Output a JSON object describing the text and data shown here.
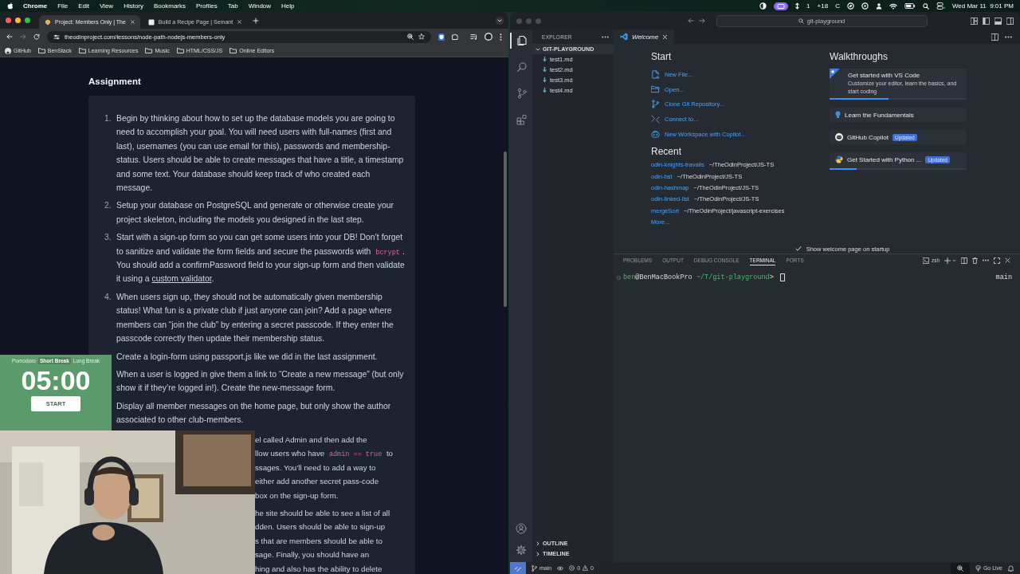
{
  "menu_bar": {
    "app": "Chrome",
    "menus": [
      "File",
      "Edit",
      "View",
      "History",
      "Bookmarks",
      "Profiles",
      "Tab",
      "Window",
      "Help"
    ],
    "status": [
      "1",
      "+18",
      "C"
    ],
    "clock": "Wed Mar 11  9:01 PM"
  },
  "browser": {
    "tabs": [
      {
        "title": "Project: Members Only | The",
        "selected": true
      },
      {
        "title": "Build a Recipe Page | Semant",
        "selected": false
      }
    ],
    "url": "theodinproject.com/lessons/node-path-nodejs-members-only",
    "bookmarks": [
      {
        "kind": "github",
        "label": "GitHub"
      },
      {
        "kind": "folder",
        "label": "BenStack"
      },
      {
        "kind": "folder",
        "label": "Learning Resources"
      },
      {
        "kind": "folder",
        "label": "Music"
      },
      {
        "kind": "folder",
        "label": "HTML/CSS/JS"
      },
      {
        "kind": "folder",
        "label": "Online Editors"
      }
    ],
    "page": {
      "heading": "Assignment",
      "items": [
        {
          "number": "1.",
          "parts": [
            {
              "text": "Begin by thinking about how to set up the database models you are going to need to accomplish your goal. You will need users with full-names (first and last), usernames (you can use email for this), passwords and membership-status. Users should be able to create messages that have a title, a timestamp and some text. Your database should keep track of who created each message."
            }
          ]
        },
        {
          "number": "2.",
          "parts": [
            {
              "text": "Setup your database on PostgreSQL and generate or otherwise create your project skeleton, including the models you designed in the last step."
            }
          ]
        },
        {
          "number": "3.",
          "parts": [
            {
              "text": "Start with a sign-up form so you can get some users into your DB! Don’t forget to sanitize and validate the form fields and secure the passwords with "
            },
            {
              "kind": "code",
              "text": "bcrypt"
            },
            {
              "text": ". You should add a confirmPassword field to your sign-up form and then validate it using a "
            },
            {
              "kind": "link",
              "text": "custom validator"
            },
            {
              "text": "."
            }
          ]
        },
        {
          "number": "4.",
          "parts": [
            {
              "text": "When users sign up, they should not be automatically given membership status! What fun is a private club if just anyone can join? Add a page where members can “join the club” by entering a secret passcode. If they enter the passcode correctly then update their membership status."
            }
          ]
        },
        {
          "parts": [
            {
              "text": "Create a login-form using passport.js like we did in the last assignment."
            }
          ]
        },
        {
          "parts": [
            {
              "text": "When a user is logged in give them a link to “Create a new message” (but only show it if they’re logged in!). Create the new-message form."
            }
          ]
        },
        {
          "parts": [
            {
              "text": "Display all member messages on the home page, but only show the author associated to other club-members."
            }
          ]
        }
      ],
      "fragments": [
        {
          "lines": [
            [
              {
                "text": "el called Admin and then add the"
              }
            ],
            [
              {
                "text": "llow users who have "
              },
              {
                "kind": "code",
                "text": "admin == true"
              },
              {
                "text": " to"
              }
            ],
            [
              {
                "text": "ssages. You’ll need to add a way to"
              }
            ],
            [
              {
                "text": "either add another secret pass-code"
              }
            ],
            [
              {
                "text": "box on the sign-up form."
              }
            ]
          ]
        },
        {
          "lines": [
            [
              {
                "text": "he site should be able to see a list of all"
              }
            ],
            [
              {
                "text": "dden. Users should be able to sign-up"
              }
            ],
            [
              {
                "text": "s that are members should be able to"
              }
            ],
            [
              {
                "text": "sage. Finally, you should have an"
              }
            ],
            [
              {
                "text": "hing and also has the ability to delete"
              }
            ]
          ]
        }
      ]
    }
  },
  "timer": {
    "modes": [
      {
        "label": "Pomodoro",
        "selected": false
      },
      {
        "label": "Short Break",
        "selected": true
      },
      {
        "label": "Long Break",
        "selected": false
      }
    ],
    "time": "05:00",
    "button": "START"
  },
  "editor": {
    "search": "git-playground",
    "activity": [
      {
        "kind": "files",
        "selected": true
      },
      {
        "kind": "search",
        "selected": false
      },
      {
        "kind": "source-control",
        "selected": false
      },
      {
        "kind": "extensions",
        "selected": false
      }
    ],
    "explorer": {
      "title": "EXPLORER",
      "folder": {
        "name": "GIT-PLAYGROUND",
        "expanded": true,
        "files": [
          "test1.md",
          "test2.md",
          "test3.md",
          "test4.md"
        ]
      },
      "sections": [
        {
          "name": "OUTLINE",
          "expanded": false
        },
        {
          "name": "TIMELINE",
          "expanded": false
        }
      ]
    },
    "tabs": [
      {
        "title": "Welcome",
        "selected": true
      }
    ],
    "welcome": {
      "start_title": "Start",
      "start": [
        {
          "kind": "new-file",
          "label": "New File..."
        },
        {
          "kind": "open",
          "label": "Open..."
        },
        {
          "kind": "clone",
          "label": "Clone Git Repository..."
        },
        {
          "kind": "connect",
          "label": "Connect to..."
        },
        {
          "kind": "copilot",
          "label": "New Workspace with Copilot..."
        }
      ],
      "recent_title": "Recent",
      "recent": [
        {
          "name": "odin-knights-travails",
          "path": "~/TheOdinProject/JS-TS"
        },
        {
          "name": "odin-bst",
          "path": "~/TheOdinProject/JS-TS"
        },
        {
          "name": "odin-hashmap",
          "path": "~/TheOdinProject/JS-TS"
        },
        {
          "name": "odin-linked-list",
          "path": "~/TheOdinProject/JS-TS"
        },
        {
          "name": "mergeSort",
          "path": "~/TheOdinProject/javascript-exercises"
        }
      ],
      "more": "More...",
      "walkthroughs_title": "Walkthroughs",
      "walkthroughs": [
        {
          "kind": "vscode",
          "title": "Get started with VS Code",
          "description": "Customize your editor, learn the basics, and start coding",
          "level": 0.43
        },
        {
          "kind": "bulb",
          "title": "Learn the Fundamentals"
        },
        {
          "kind": "copilot",
          "title": "GitHub Copilot",
          "badge": "Updated"
        },
        {
          "kind": "python",
          "title": "Get Started with Python ...",
          "badge": "Updated",
          "level": 0.2
        }
      ],
      "show_on_startup": {
        "label": "Show welcome page on startup",
        "checked": true
      }
    },
    "panel": {
      "tabs": [
        {
          "label": "PROBLEMS",
          "selected": false
        },
        {
          "label": "OUTPUT",
          "selected": false
        },
        {
          "label": "DEBUG CONSOLE",
          "selected": false
        },
        {
          "label": "TERMINAL",
          "selected": true
        },
        {
          "label": "PORTS",
          "selected": false
        }
      ],
      "shell": "zsh",
      "terminal": {
        "user": "ben",
        "host": "@BenMacBookPro",
        "path": " ~/T/git-playground",
        "prompt": ">",
        "branch": "main"
      }
    },
    "status_bar": {
      "branch": "main",
      "errors": "0",
      "warnings": "0",
      "go_live": "Go Live"
    }
  }
}
